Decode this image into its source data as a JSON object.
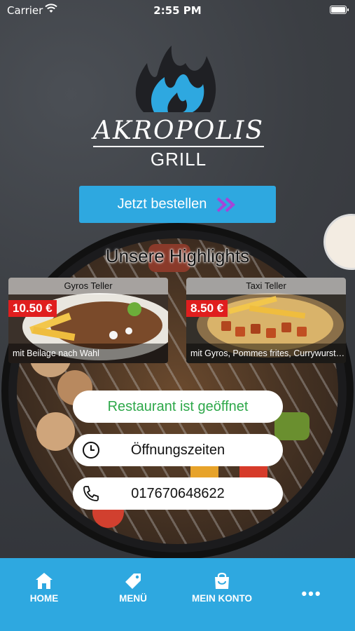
{
  "status_bar": {
    "carrier": "Carrier",
    "time": "2:55 PM"
  },
  "brand": {
    "name": "AKROPOLIS",
    "subtitle": "GRILL"
  },
  "order_button": {
    "label": "Jetzt bestellen"
  },
  "highlights": {
    "title": "Unsere Highlights",
    "items": [
      {
        "name": "Gyros Teller",
        "price": "10.50 €",
        "description": "mit Beilage nach Wahl"
      },
      {
        "name": "Taxi Teller",
        "price": "8.50 €",
        "description": "mit Gyros, Pommes frites, Currywurst, ..."
      }
    ]
  },
  "info": {
    "status": "Restaurant ist geöffnet",
    "hours_label": "Öffnungszeiten",
    "phone": "017670648622"
  },
  "nav": {
    "items": [
      {
        "label": "HOME",
        "icon": "home-icon"
      },
      {
        "label": "MENÜ",
        "icon": "tag-icon"
      },
      {
        "label": "MEIN KONTO",
        "icon": "bag-icon"
      },
      {
        "label": "•••",
        "icon": "more-icon"
      }
    ]
  },
  "colors": {
    "accent": "#2ea8e0",
    "open_green": "#2ea84a",
    "price_red": "#e01e1e"
  }
}
